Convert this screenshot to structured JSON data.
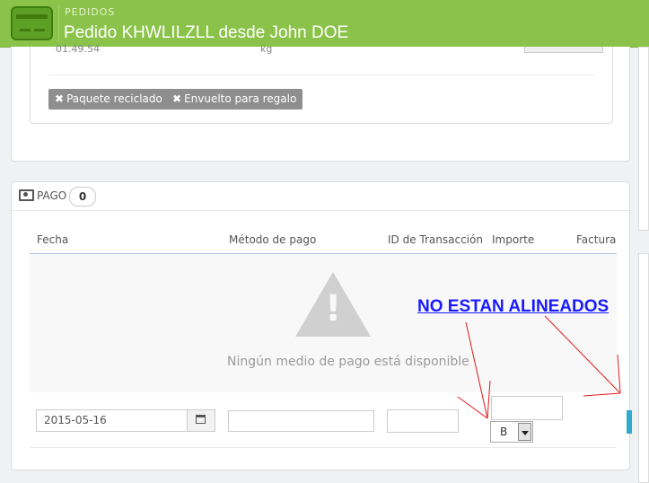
{
  "header": {
    "section": "PEDIDOS",
    "title": "Pedido KHWLILZLL desde John DOE",
    "accent_color": "#8bc34a",
    "icon": "credit-card-icon"
  },
  "shipping": {
    "cut_value": "01.49.54",
    "cut_unit": "kg",
    "tags": [
      {
        "label": "Paquete reciclado",
        "icon": "x-icon"
      },
      {
        "label": "Envuelto para regalo",
        "icon": "x-icon"
      }
    ]
  },
  "pago": {
    "title": "PAGO",
    "count": "0",
    "icon": "money-icon",
    "columns": [
      "Fecha",
      "Método de pago",
      "ID de Transacción",
      "Importe",
      "Factura"
    ],
    "empty_message": "Ningún medio de pago está disponible",
    "form": {
      "date_value": "2015-05-16",
      "currency_selected": "B"
    }
  },
  "annotation": {
    "text": "NO ESTAN ALINEADOS",
    "color": "#1a1aff",
    "arrow_color": "#e01818"
  }
}
